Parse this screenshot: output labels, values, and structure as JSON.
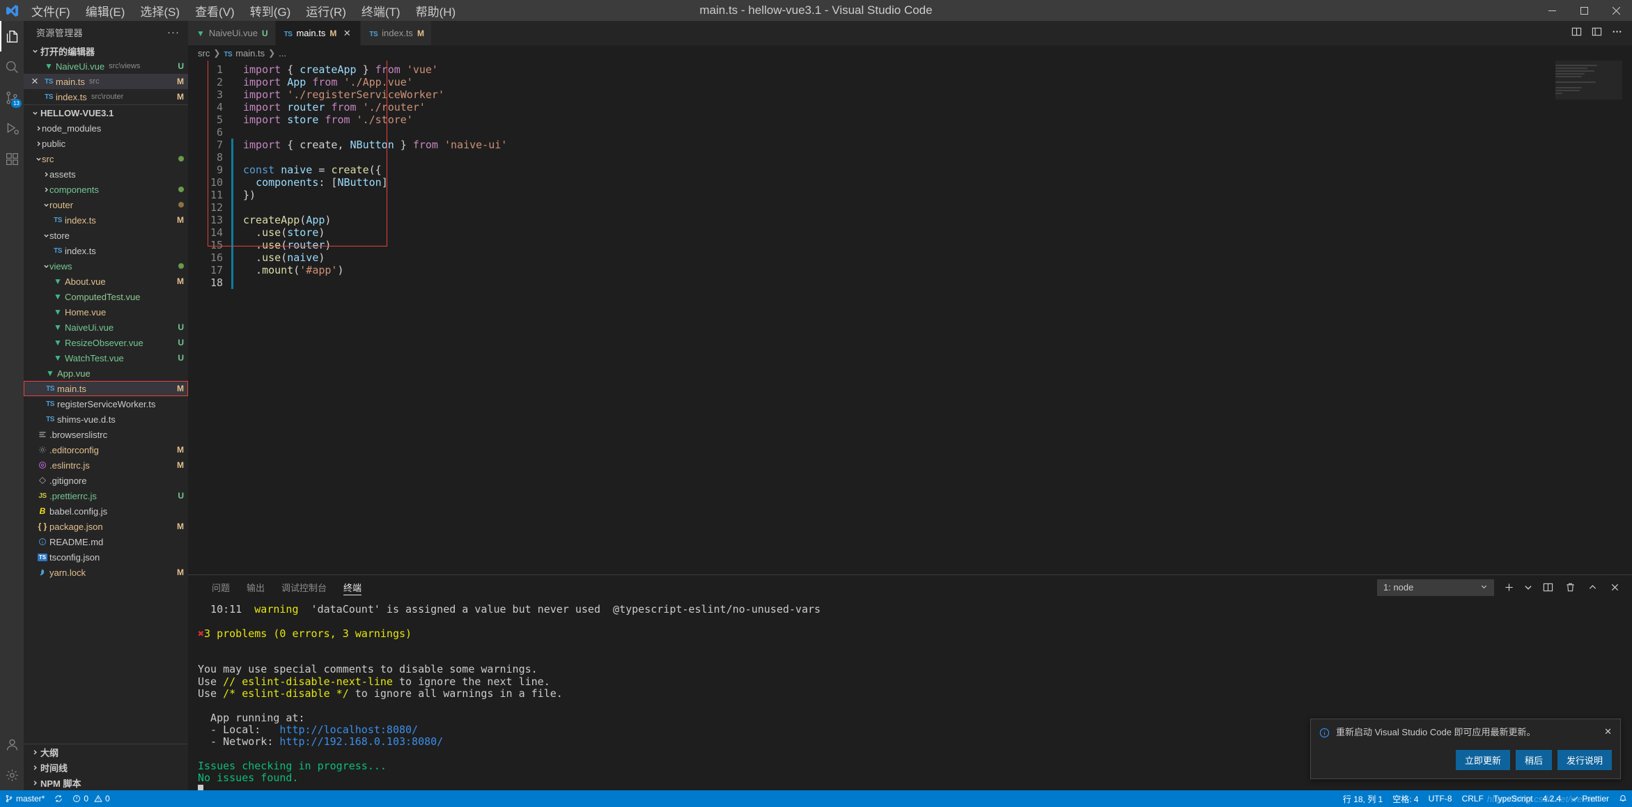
{
  "titlebar": {
    "window_title": "main.ts - hellow-vue3.1 - Visual Studio Code",
    "logo_icon": "vscode-logo",
    "menus": [
      {
        "label": "文件(F)",
        "name": "menu-file"
      },
      {
        "label": "编辑(E)",
        "name": "menu-edit"
      },
      {
        "label": "选择(S)",
        "name": "menu-selection"
      },
      {
        "label": "查看(V)",
        "name": "menu-view"
      },
      {
        "label": "转到(G)",
        "name": "menu-go"
      },
      {
        "label": "运行(R)",
        "name": "menu-run"
      },
      {
        "label": "终端(T)",
        "name": "menu-terminal"
      },
      {
        "label": "帮助(H)",
        "name": "menu-help"
      }
    ],
    "window_controls": [
      "minimize",
      "maximize",
      "close"
    ]
  },
  "activitybar": {
    "items": [
      {
        "name": "explorer",
        "icon": "files-icon",
        "active": true,
        "badge": ""
      },
      {
        "name": "search",
        "icon": "search-icon",
        "active": false,
        "badge": ""
      },
      {
        "name": "source-control",
        "icon": "source-control-icon",
        "active": false,
        "badge": "13"
      },
      {
        "name": "run-debug",
        "icon": "run-debug-icon",
        "active": false,
        "badge": ""
      },
      {
        "name": "extensions",
        "icon": "extensions-icon",
        "active": false,
        "badge": ""
      }
    ],
    "bottom": [
      {
        "name": "accounts",
        "icon": "account-icon"
      },
      {
        "name": "manage",
        "icon": "gear-icon"
      }
    ]
  },
  "sidebar": {
    "title": "资源管理器",
    "more_actions": "···",
    "open_editors": {
      "label": "打开的编辑器",
      "items": [
        {
          "name": "NaiveUi.vue",
          "path": "src\\views",
          "icon": "vue-icon",
          "badge": "U",
          "badge_type": "U",
          "color": "untracked",
          "selected": false,
          "close": false
        },
        {
          "name": "main.ts",
          "path": "src",
          "icon": "ts-icon",
          "badge": "M",
          "badge_type": "M",
          "color": "mod",
          "selected": true,
          "close": true
        },
        {
          "name": "index.ts",
          "path": "src\\router",
          "icon": "ts-icon",
          "badge": "M",
          "badge_type": "M",
          "color": "mod",
          "selected": false,
          "close": false
        }
      ]
    },
    "project": {
      "label": "HELLOW-VUE3.1",
      "tree": [
        {
          "label": "node_modules",
          "type": "folder",
          "depth": 1,
          "expanded": false,
          "color": "dim",
          "badge": "",
          "dot": ""
        },
        {
          "label": "public",
          "type": "folder",
          "depth": 1,
          "expanded": false,
          "color": "dim",
          "badge": "",
          "dot": ""
        },
        {
          "label": "src",
          "type": "folder",
          "depth": 1,
          "expanded": true,
          "color": "mod",
          "badge": "",
          "dot": "#6b9a4a"
        },
        {
          "label": "assets",
          "type": "folder",
          "depth": 2,
          "expanded": false,
          "color": "dim",
          "badge": "",
          "dot": ""
        },
        {
          "label": "components",
          "type": "folder",
          "depth": 2,
          "expanded": false,
          "color": "untracked",
          "badge": "",
          "dot": "#6b9a4a"
        },
        {
          "label": "router",
          "type": "folder",
          "depth": 2,
          "expanded": true,
          "color": "mod",
          "badge": "",
          "dot": "#8a7340"
        },
        {
          "label": "index.ts",
          "type": "ts",
          "depth": 3,
          "color": "mod",
          "badge": "M",
          "badge_type": "M",
          "dot": ""
        },
        {
          "label": "store",
          "type": "folder",
          "depth": 2,
          "expanded": true,
          "color": "dim",
          "badge": "",
          "dot": ""
        },
        {
          "label": "index.ts",
          "type": "ts",
          "depth": 3,
          "color": "dim",
          "badge": "",
          "dot": ""
        },
        {
          "label": "views",
          "type": "folder",
          "depth": 2,
          "expanded": true,
          "color": "untracked",
          "badge": "",
          "dot": "#6b9a4a"
        },
        {
          "label": "About.vue",
          "type": "vue",
          "depth": 3,
          "color": "vue-mod",
          "badge": "M",
          "badge_type": "M",
          "dot": ""
        },
        {
          "label": "ComputedTest.vue",
          "type": "vue",
          "depth": 3,
          "color": "vue",
          "badge": "",
          "dot": ""
        },
        {
          "label": "Home.vue",
          "type": "vue",
          "depth": 3,
          "color": "vue-mod",
          "badge": "",
          "dot": ""
        },
        {
          "label": "NaiveUi.vue",
          "type": "vue",
          "depth": 3,
          "color": "untracked",
          "badge": "U",
          "badge_type": "U",
          "dot": ""
        },
        {
          "label": "ResizeObsever.vue",
          "type": "vue",
          "depth": 3,
          "color": "untracked",
          "badge": "U",
          "badge_type": "U",
          "dot": ""
        },
        {
          "label": "WatchTest.vue",
          "type": "vue",
          "depth": 3,
          "color": "untracked",
          "badge": "U",
          "badge_type": "U",
          "dot": ""
        },
        {
          "label": "App.vue",
          "type": "vue",
          "depth": 2,
          "color": "vue",
          "badge": "",
          "dot": ""
        },
        {
          "label": "main.ts",
          "type": "ts",
          "depth": 2,
          "color": "mod",
          "badge": "M",
          "badge_type": "M",
          "dot": "",
          "selected": true,
          "outlined": true
        },
        {
          "label": "registerServiceWorker.ts",
          "type": "ts",
          "depth": 2,
          "color": "dim",
          "badge": "",
          "dot": ""
        },
        {
          "label": "shims-vue.d.ts",
          "type": "ts",
          "depth": 2,
          "color": "dim",
          "badge": "",
          "dot": ""
        },
        {
          "label": ".browserslistrc",
          "type": "list",
          "depth": 1,
          "color": "dim",
          "badge": "",
          "dot": ""
        },
        {
          "label": ".editorconfig",
          "type": "gear",
          "depth": 1,
          "color": "mod",
          "badge": "M",
          "badge_type": "M",
          "dot": ""
        },
        {
          "label": ".eslintrc.js",
          "type": "eslint",
          "depth": 1,
          "color": "mod",
          "badge": "M",
          "badge_type": "M",
          "dot": ""
        },
        {
          "label": ".gitignore",
          "type": "git",
          "depth": 1,
          "color": "dim",
          "badge": "",
          "dot": ""
        },
        {
          "label": ".prettierrc.js",
          "type": "js",
          "depth": 1,
          "color": "untracked",
          "badge": "U",
          "badge_type": "U",
          "dot": ""
        },
        {
          "label": "babel.config.js",
          "type": "babel",
          "depth": 1,
          "color": "dim",
          "badge": "",
          "dot": ""
        },
        {
          "label": "package.json",
          "type": "json",
          "depth": 1,
          "color": "mod",
          "badge": "M",
          "badge_type": "M",
          "dot": ""
        },
        {
          "label": "README.md",
          "type": "info",
          "depth": 1,
          "color": "dim",
          "badge": "",
          "dot": ""
        },
        {
          "label": "tsconfig.json",
          "type": "tsconfig",
          "depth": 1,
          "color": "dim",
          "badge": "",
          "dot": ""
        },
        {
          "label": "yarn.lock",
          "type": "yarn",
          "depth": 1,
          "color": "mod",
          "badge": "M",
          "badge_type": "M",
          "dot": ""
        }
      ]
    },
    "bottom_sections": [
      {
        "label": "大纲",
        "name": "outline-section"
      },
      {
        "label": "时间线",
        "name": "timeline-section"
      },
      {
        "label": "NPM 脚本",
        "name": "npm-scripts-section"
      }
    ]
  },
  "editor": {
    "tabs": [
      {
        "label": "NaiveUi.vue",
        "icon": "vue-icon",
        "badge": "U",
        "badge_type": "U",
        "active": false,
        "closeable": false
      },
      {
        "label": "main.ts",
        "icon": "ts-icon",
        "badge": "M",
        "badge_type": "M",
        "active": true,
        "closeable": true
      },
      {
        "label": "index.ts",
        "icon": "ts-icon",
        "badge": "M",
        "badge_type": "M",
        "active": false,
        "closeable": false
      }
    ],
    "actions": [
      "split-editor-icon",
      "layout-icon",
      "more-actions-icon"
    ],
    "breadcrumb": [
      "src",
      "main.ts",
      "..."
    ],
    "line_count": 18,
    "current_line": 18,
    "gutter_changes": {
      "modified_lines": [
        7,
        8,
        9,
        10,
        11,
        12,
        13,
        14,
        15,
        16,
        17,
        18
      ]
    },
    "code_lines": [
      "import { createApp } from 'vue'",
      "import App from './App.vue'",
      "import './registerServiceWorker'",
      "import router from './router'",
      "import store from './store'",
      "",
      "import { create, NButton } from 'naive-ui'",
      "",
      "const naive = create({",
      "  components: [NButton]",
      "})",
      "",
      "createApp(App)",
      "  .use(store)",
      "  .use(router)",
      "  .use(naive)",
      "  .mount('#app')",
      ""
    ]
  },
  "panel": {
    "tabs": [
      {
        "label": "问题",
        "name": "panel-tab-problems",
        "active": false
      },
      {
        "label": "输出",
        "name": "panel-tab-output",
        "active": false
      },
      {
        "label": "调试控制台",
        "name": "panel-tab-debug-console",
        "active": false
      },
      {
        "label": "终端",
        "name": "panel-tab-terminal",
        "active": true
      }
    ],
    "terminal_select": "1: node",
    "actions": [
      "new-terminal-icon",
      "terminal-dropdown-icon",
      "split-terminal-icon",
      "kill-terminal-icon",
      "maximize-panel-icon",
      "close-panel-icon"
    ],
    "terminal_lines": [
      {
        "text": "  10:11  warning  'dataCount' is assigned a value but never used  @typescript-eslint/no-unused-vars",
        "parts": [
          {
            "t": "  10:11  ",
            "c": "dim"
          },
          {
            "t": "warning",
            "c": "warn"
          },
          {
            "t": "  'dataCount' is assigned a value but never used  @typescript-eslint/no-unused-vars",
            "c": "dim"
          }
        ]
      },
      {
        "text": ""
      },
      {
        "text": "✖ 3 problems (0 errors, 3 warnings)",
        "parts": [
          {
            "t": "✖",
            "c": "red"
          },
          {
            "t": "3 problems (0 errors, 3 warnings)",
            "c": "yellow"
          }
        ]
      },
      {
        "text": ""
      },
      {
        "text": ""
      },
      {
        "text": "You may use special comments to disable some warnings.",
        "parts": [
          {
            "t": "You may use special comments to disable some warnings.",
            "c": "dim"
          }
        ]
      },
      {
        "text": "Use // eslint-disable-next-line to ignore the next line.",
        "parts": [
          {
            "t": "Use ",
            "c": "dim"
          },
          {
            "t": "// eslint-disable-next-line",
            "c": "yellow"
          },
          {
            "t": " to ignore the next line.",
            "c": "dim"
          }
        ]
      },
      {
        "text": "Use /* eslint-disable */ to ignore all warnings in a file.",
        "parts": [
          {
            "t": "Use ",
            "c": "dim"
          },
          {
            "t": "/* eslint-disable */",
            "c": "yellow"
          },
          {
            "t": " to ignore all warnings in a file.",
            "c": "dim"
          }
        ]
      },
      {
        "text": ""
      },
      {
        "text": "  App running at:",
        "parts": [
          {
            "t": "  App running at:",
            "c": "dim"
          }
        ]
      },
      {
        "text": "  - Local:   http://localhost:8080/",
        "parts": [
          {
            "t": "  - Local:   ",
            "c": "dim"
          },
          {
            "t": "http://localhost:8080/",
            "c": "blue"
          }
        ]
      },
      {
        "text": "  - Network: http://192.168.0.103:8080/",
        "parts": [
          {
            "t": "  - Network: ",
            "c": "dim"
          },
          {
            "t": "http://192.168.0.103:8080/",
            "c": "blue"
          }
        ]
      },
      {
        "text": ""
      },
      {
        "text": "Issues checking in progress...",
        "parts": [
          {
            "t": "Issues checking in progress...",
            "c": "green"
          }
        ]
      },
      {
        "text": "No issues found.",
        "parts": [
          {
            "t": "No issues found.",
            "c": "green"
          }
        ]
      }
    ]
  },
  "statusbar": {
    "left": [
      {
        "label": "master*",
        "icon": "source-control-branch-icon",
        "name": "status-branch"
      },
      {
        "label": "",
        "icon": "sync-icon",
        "name": "status-sync"
      },
      {
        "label": "0",
        "icon": "error-icon",
        "name": "status-errors",
        "second_icon": "warning-icon",
        "second_label": "0"
      }
    ],
    "right": [
      {
        "label": "行 18, 列 1",
        "name": "status-line-col"
      },
      {
        "label": "空格: 4",
        "name": "status-indentation"
      },
      {
        "label": "UTF-8",
        "name": "status-encoding"
      },
      {
        "label": "CRLF",
        "name": "status-eol"
      },
      {
        "label": "TypeScript",
        "name": "status-language-mode"
      },
      {
        "label": "4.2.4",
        "name": "status-ts-version"
      },
      {
        "label": "Prettier",
        "icon": "check-icon",
        "name": "status-prettier"
      },
      {
        "label": "",
        "icon": "bell-icon",
        "name": "status-notifications"
      }
    ]
  },
  "notification": {
    "icon": "info-icon",
    "message": "重新启动 Visual Studio Code 即可应用最新更新。",
    "close": "✕",
    "buttons": [
      {
        "label": "立即更新",
        "name": "update-now-button"
      },
      {
        "label": "稍后",
        "name": "later-button"
      },
      {
        "label": "发行说明",
        "name": "release-notes-button"
      }
    ]
  },
  "watermark": "https://blog.csdn.net/weixin"
}
